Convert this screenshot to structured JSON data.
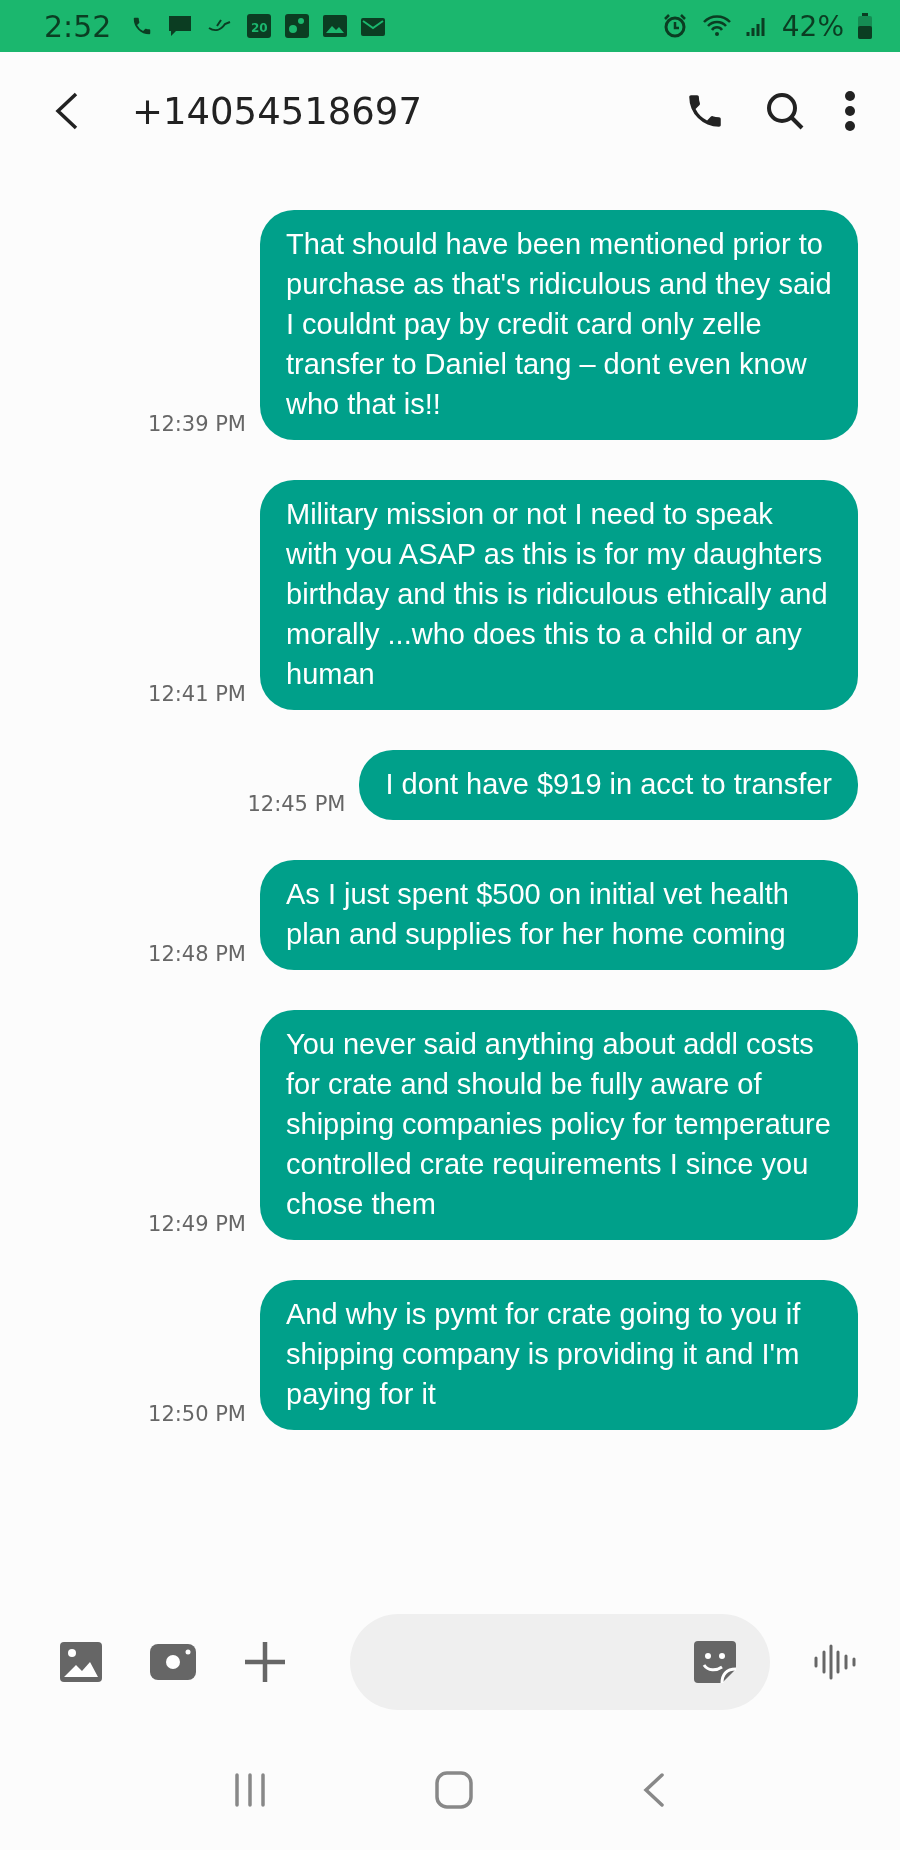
{
  "status_bar": {
    "time": "2:52",
    "calendar_day": "20",
    "battery": "42%"
  },
  "header": {
    "title": "+14054518697"
  },
  "messages": [
    {
      "text": "That should have been mentioned prior to purchase as that's ridiculous and they said I couldnt pay by credit card only zelle transfer to Daniel tang – dont even know who that is!!",
      "time": "12:39 PM"
    },
    {
      "text": "Military mission or not I need to speak with you ASAP as this is for my daughters birthday and this is ridiculous  ethically and morally ...who does this to a child or any human",
      "time": "12:41 PM"
    },
    {
      "text": "I dont have $919 in acct to transfer",
      "time": "12:45 PM"
    },
    {
      "text": "As I just spent $500 on initial vet health plan and supplies for her home coming",
      "time": "12:48 PM"
    },
    {
      "text": "You never said anything about addl costs for crate and should be fully aware of shipping companies policy for temperature controlled crate requirements I since you chose them",
      "time": "12:49 PM"
    },
    {
      "text": "And why is pymt for crate going to you if shipping company is providing it and I'm paying for it",
      "time": "12:50 PM"
    }
  ]
}
